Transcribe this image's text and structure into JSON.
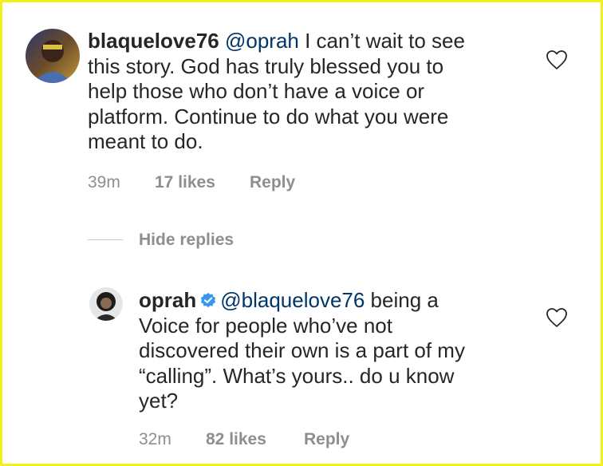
{
  "comment": {
    "username": "blaquelove76",
    "mention": "@oprah",
    "text_line1_rest": " I can’t wait to see",
    "line2": "this story. God has truly blessed you to",
    "line3": "help those who don’t have a voice or",
    "line4": "platform. Continue to do what you were",
    "line5": "meant to do.",
    "time": "39m",
    "likes": "17 likes",
    "reply": "Reply"
  },
  "hide_replies": "Hide replies",
  "reply": {
    "username": "oprah",
    "verified": true,
    "mention": "@blaquelove76",
    "text_line1_rest": " being a",
    "line2": "Voice for people who’ve not",
    "line3": "discovered their own is a part of my",
    "line4": "“calling”. What’s yours.. do u know",
    "line5": "yet?",
    "time": "32m",
    "likes": "82 likes",
    "reply": "Reply"
  },
  "colors": {
    "border": "#f2f21a",
    "text": "#262626",
    "mention": "#003569",
    "meta": "#8e8e8e",
    "verified": "#3897f0"
  }
}
